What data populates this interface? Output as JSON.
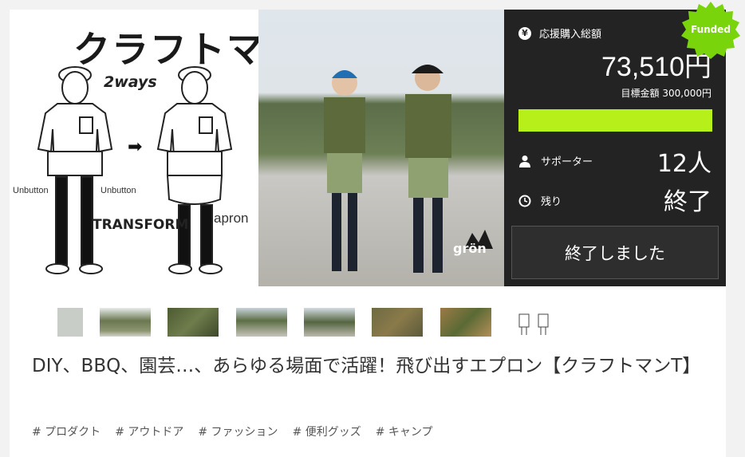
{
  "hero": {
    "title": "クラフトマンTシャツ",
    "tagline": "2ways",
    "transform_label": "TRANSFORM",
    "unbutton_left": "Unbutton",
    "unbutton_right": "Unbutton",
    "apron_label": "apron",
    "brand": "grön"
  },
  "funding": {
    "status_badge": "Funded",
    "total_label": "応援購入総額",
    "total_amount": "73,510円",
    "goal_text": "目標金額 300,000円",
    "progress_fraction": 1.0,
    "supporters_label": "サポーター",
    "supporters_value": "12人",
    "remaining_label": "残り",
    "remaining_value": "終了",
    "ended_button": "終了しました",
    "colors": {
      "panel": "#232323",
      "progress": "#b7ef1b",
      "badge": "#79d40c"
    }
  },
  "thumbnails": [
    {
      "name": "thumb-1"
    },
    {
      "name": "thumb-2"
    },
    {
      "name": "thumb-3"
    },
    {
      "name": "thumb-4"
    },
    {
      "name": "thumb-5"
    },
    {
      "name": "thumb-6"
    },
    {
      "name": "thumb-7"
    },
    {
      "name": "thumb-8"
    }
  ],
  "project_title": "DIY、BBQ、園芸…、あらゆる場面で活躍！飛び出すエプロン【クラフトマンT】",
  "tags": [
    "# プロダクト",
    "# アウトドア",
    "# ファッション",
    "# 便利グッズ",
    "# キャンプ"
  ]
}
